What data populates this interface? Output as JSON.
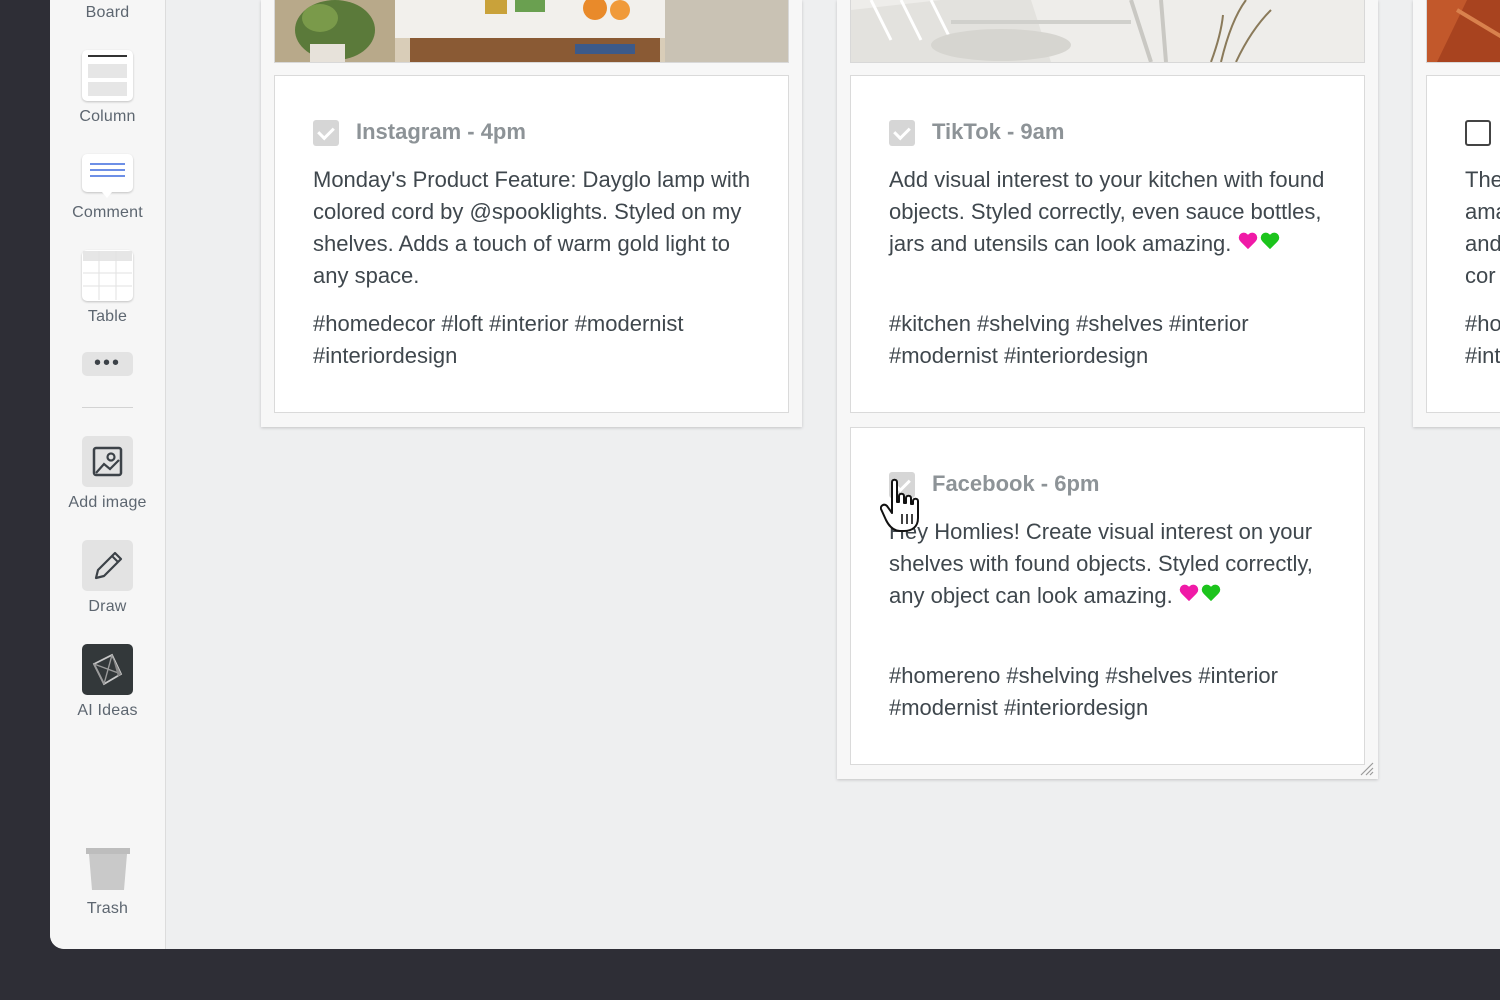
{
  "sidebar": {
    "tools": [
      {
        "label": "Board",
        "icon": "board-icon"
      },
      {
        "label": "Column",
        "icon": "column-icon"
      },
      {
        "label": "Comment",
        "icon": "comment-icon"
      },
      {
        "label": "Table",
        "icon": "table-icon"
      },
      {
        "label": "•••",
        "icon": "more-icon"
      },
      {
        "label": "Add image",
        "icon": "add-image-icon"
      },
      {
        "label": "Draw",
        "icon": "pencil-icon"
      },
      {
        "label": "AI Ideas",
        "icon": "ai-ideas-icon"
      },
      {
        "label": "Trash",
        "icon": "trash-icon"
      }
    ]
  },
  "board": {
    "cards": [
      {
        "title": "Instagram - 4pm",
        "checked": true,
        "body": "Monday's Product Feature: Dayglo lamp with colored cord by @spooklights. Styled on my shelves. Adds a touch of warm gold light to any space.",
        "tags": "#homedecor #loft #interior #modernist #interiordesign"
      },
      {
        "title": "TikTok - 9am",
        "checked": true,
        "body": "Add visual interest to your kitchen with found objects. Styled correctly, even sauce bottles, jars and utensils can look amazing.",
        "tags": "#kitchen #shelving #shelves #interior #modernist #interiordesign"
      },
      {
        "title": "Facebook - 6pm",
        "checked": true,
        "body": "Hey Homlies! Create visual interest on your shelves with found objects. Styled correctly, any object can look amazing.",
        "tags": "#homereno #shelving #shelves #interior #modernist #interiordesign"
      },
      {
        "title": "",
        "checked": false,
        "body_lines": [
          "The",
          "ama",
          "and",
          "cor"
        ],
        "tag_lines": [
          "#ho",
          "#int"
        ]
      }
    ]
  },
  "colors": {
    "sidebar_bg": "#f6f6f6",
    "board_bg": "#eeeff0",
    "title_gray": "#8d9397",
    "text": "#3f474d",
    "heart_pink": "#f01aa7",
    "heart_green": "#1cc41c"
  }
}
